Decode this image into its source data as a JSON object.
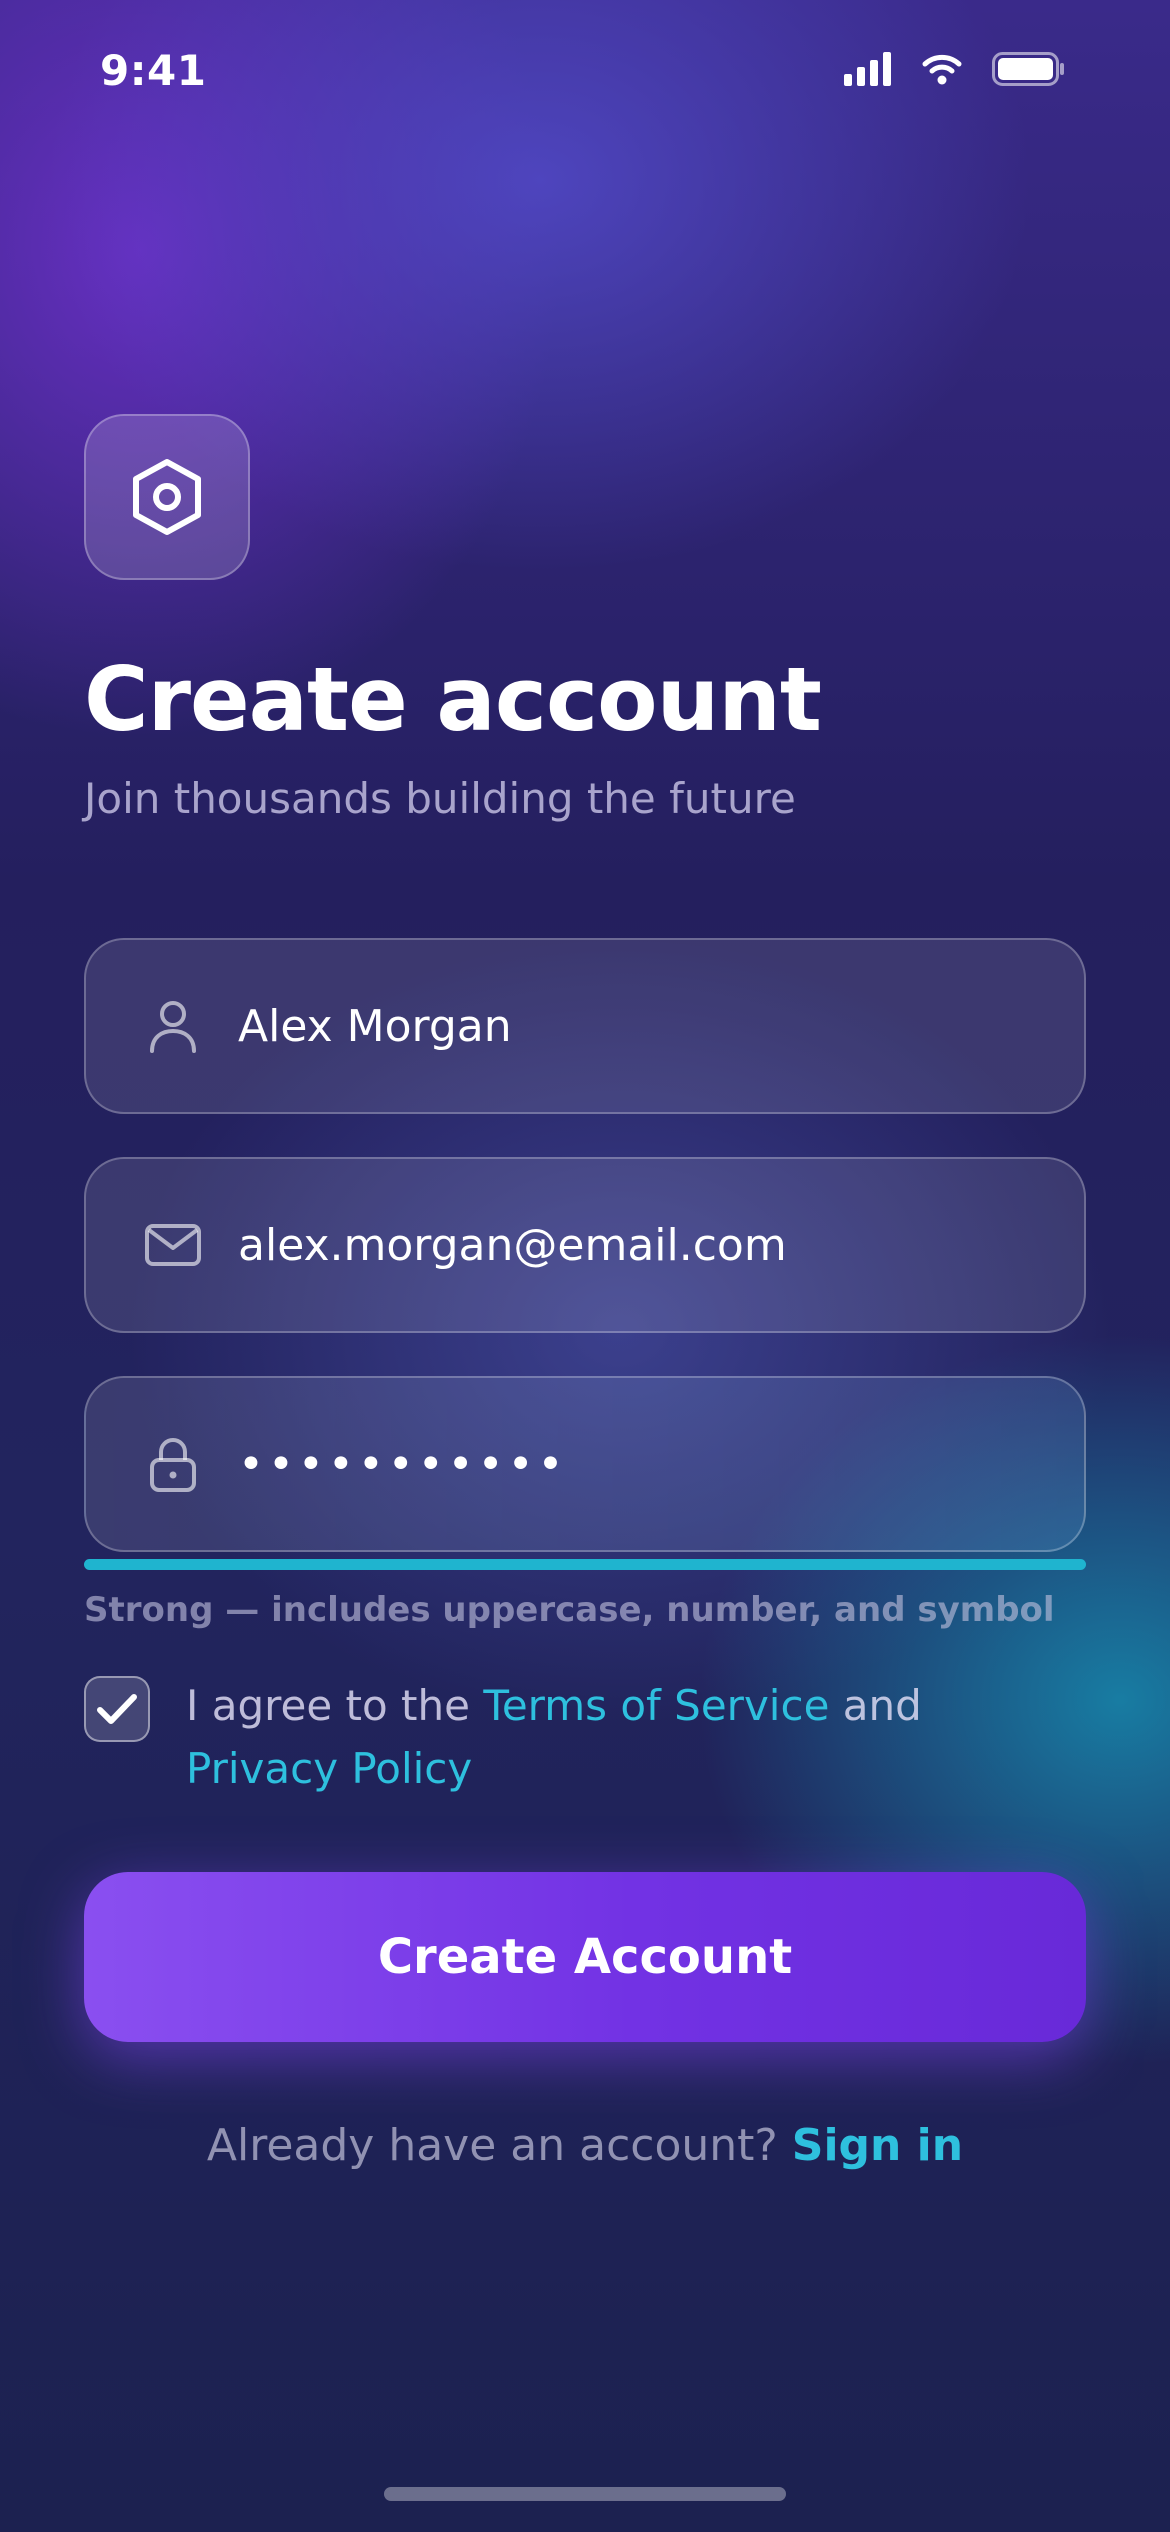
{
  "status_bar": {
    "time": "9:41"
  },
  "header": {
    "logo_icon": "hexagon-bolt-icon",
    "title": "Create account",
    "subtitle": "Join thousands building the future"
  },
  "form": {
    "name": {
      "icon": "user-icon",
      "value": "Alex Morgan"
    },
    "email": {
      "icon": "mail-icon",
      "value": "alex.morgan@email.com"
    },
    "password": {
      "icon": "lock-icon",
      "value": "•••••••••••"
    },
    "password_strength": {
      "level": 1.0,
      "color": "#1fb4cf"
    },
    "password_hint": "Strong — includes uppercase, number, and symbol"
  },
  "agreement": {
    "checked": true,
    "prefix": "I agree to the",
    "terms_link": "Terms of Service",
    "joiner": "and",
    "privacy_link": "Privacy Policy"
  },
  "cta": {
    "label": "Create Account"
  },
  "footer": {
    "prompt": "Already have an account?",
    "signin_link": "Sign in"
  },
  "colors": {
    "accent": "#2ec0de",
    "button": "#7232e4"
  }
}
